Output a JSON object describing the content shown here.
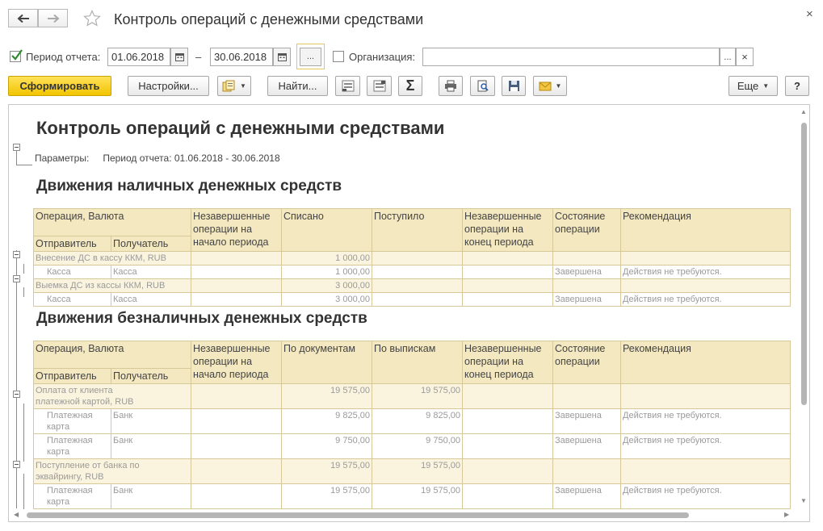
{
  "window": {
    "title": "Контроль операций с денежными средствами",
    "close_glyph": "×"
  },
  "params": {
    "period_label": "Период отчета:",
    "period_checked": true,
    "date_from": "01.06.2018",
    "date_to": "30.06.2018",
    "dash": "–",
    "ellipsis": "...",
    "org_label": "Организация:",
    "org_checked": false,
    "org_value": "",
    "org_select": "...",
    "org_clear": "×"
  },
  "toolbar": {
    "generate": "Сформировать",
    "settings": "Настройки...",
    "find": "Найти...",
    "sum_glyph": "Σ",
    "more": "Еще",
    "help": "?"
  },
  "report": {
    "title": "Контроль операций с денежными средствами",
    "params_label": "Параметры:",
    "params_value": "Период отчета: 01.06.2018 - 30.06.2018",
    "cash": {
      "title": "Движения наличных денежных средств",
      "headers": {
        "operation": "Операция, Валюта",
        "sender": "Отправитель",
        "receiver": "Получатель",
        "pending_start": "Незавершенные операции на начало периода",
        "col_a": "Списано",
        "col_b": "Поступило",
        "pending_end": "Незавершенные операции на конец периода",
        "state": "Состояние операции",
        "recommendation": "Рекомендация"
      },
      "rows": [
        {
          "type": "g",
          "name": "Внесение ДС в кассу ККМ, RUB",
          "a": "1 000,00",
          "b": "",
          "state": "",
          "rec": ""
        },
        {
          "type": "d",
          "sender": "Касса",
          "receiver": "Касса",
          "a": "1 000,00",
          "b": "",
          "state": "Завершена",
          "rec": "Действия не требуются."
        },
        {
          "type": "g",
          "name": "Выемка ДС из кассы ККМ, RUB",
          "a": "3 000,00",
          "b": "",
          "state": "",
          "rec": ""
        },
        {
          "type": "d",
          "sender": "Касса",
          "receiver": "Касса",
          "a": "3 000,00",
          "b": "",
          "state": "Завершена",
          "rec": "Действия не требуются."
        }
      ]
    },
    "noncash": {
      "title": "Движения безналичных денежных средств",
      "headers": {
        "operation": "Операция, Валюта",
        "sender": "Отправитель",
        "receiver": "Получатель",
        "pending_start": "Незавершенные операции на начало периода",
        "col_a": "По документам",
        "col_b": "По выпискам",
        "pending_end": "Незавершенные операции на конец периода",
        "state": "Состояние операции",
        "recommendation": "Рекомендация"
      },
      "rows": [
        {
          "type": "g",
          "name": "Оплата от клиента платежной картой, RUB",
          "a": "19 575,00",
          "b": "19 575,00",
          "state": "",
          "rec": ""
        },
        {
          "type": "d",
          "sender": "Платежная карта",
          "receiver": "Банк",
          "a": "9 825,00",
          "b": "9 825,00",
          "state": "Завершена",
          "rec": "Действия не требуются."
        },
        {
          "type": "d",
          "sender": "Платежная карта",
          "receiver": "Банк",
          "a": "9 750,00",
          "b": "9 750,00",
          "state": "Завершена",
          "rec": "Действия не требуются."
        },
        {
          "type": "g",
          "name": "Поступление от банка по эквайрингу, RUB",
          "a": "19 575,00",
          "b": "19 575,00",
          "state": "",
          "rec": ""
        },
        {
          "type": "d",
          "sender": "Платежная карта",
          "receiver": "Банк",
          "a": "19 575,00",
          "b": "19 575,00",
          "state": "Завершена",
          "rec": "Действия не требуются."
        }
      ]
    }
  },
  "colors": {
    "primary_button": "#f2c400",
    "header_fill": "#f4e8c0",
    "group_fill": "#faf4df",
    "grid_border": "#d6c899"
  }
}
